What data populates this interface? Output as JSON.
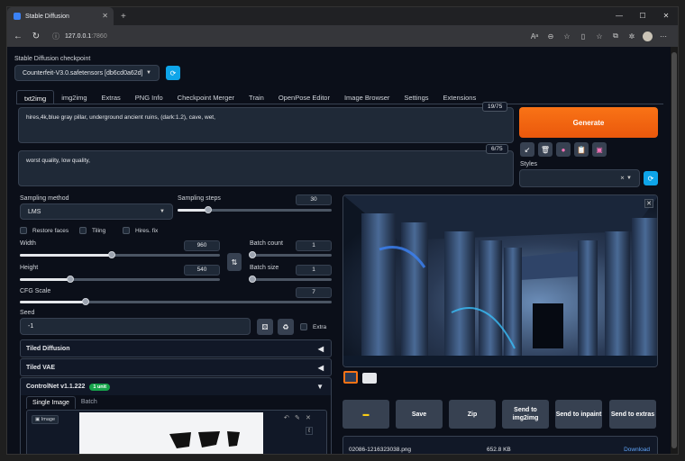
{
  "browser": {
    "tab_title": "Stable Diffusion",
    "url_host": "127.0.0.1",
    "url_port": ":7860"
  },
  "checkpoint": {
    "label": "Stable Diffusion checkpoint",
    "value": "Counterfeit-V3.0.safetensors [db6cd0a62d]"
  },
  "tabs": [
    "txt2img",
    "img2img",
    "Extras",
    "PNG Info",
    "Checkpoint Merger",
    "Train",
    "OpenPose Editor",
    "Image Browser",
    "Settings",
    "Extensions"
  ],
  "prompt": {
    "positive": "hires,4k,blue gray pillar, underground ancient ruins, (dark:1.2), cave, wet,",
    "positive_count": "19/75",
    "negative": "worst quality, low quality,",
    "negative_count": "6/75"
  },
  "generate_label": "Generate",
  "styles_label": "Styles",
  "sampling": {
    "method_label": "Sampling method",
    "method_value": "LMS",
    "steps_label": "Sampling steps",
    "steps_value": "30",
    "steps_fraction": 0.2
  },
  "checks": {
    "restore_faces": "Restore faces",
    "tiling": "Tiling",
    "hires_fix": "Hires. fix"
  },
  "size": {
    "width_label": "Width",
    "width_value": "960",
    "height_label": "Height",
    "height_value": "540",
    "batch_count_label": "Batch count",
    "batch_count_value": "1",
    "batch_size_label": "Batch size",
    "batch_size_value": "1"
  },
  "cfg": {
    "label": "CFG Scale",
    "value": "7"
  },
  "seed": {
    "label": "Seed",
    "value": "-1",
    "extra_label": "Extra"
  },
  "accordions": {
    "tiled_diffusion": "Tiled Diffusion",
    "tiled_vae": "Tiled VAE",
    "controlnet": "ControlNet v1.1.222",
    "controlnet_badge": "1 unit"
  },
  "controlnet_tabs": {
    "single": "Single Image",
    "batch": "Batch"
  },
  "image_label": "Image",
  "output_buttons": {
    "save": "Save",
    "zip": "Zip",
    "send_img2img": "Send to img2img",
    "send_inpaint": "Send to inpaint",
    "send_extras": "Send to extras"
  },
  "file": {
    "name": "02086-1216323038.png",
    "size": "652.8 KB",
    "download": "Download"
  },
  "colors": {
    "accent_orange": "#f97316",
    "tool_blue": "#0ea5e9",
    "background": "#0b0f19"
  }
}
